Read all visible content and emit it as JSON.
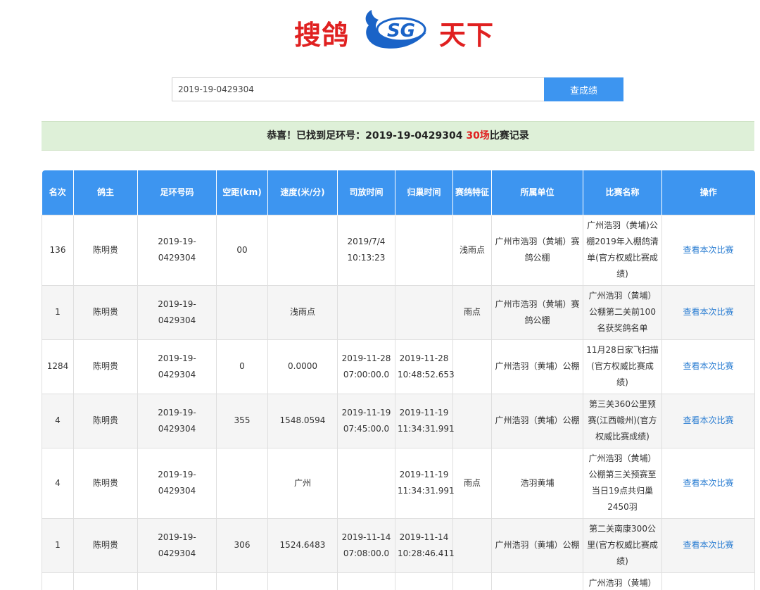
{
  "logo": {
    "left_text": "搜鸽",
    "right_text": "天下",
    "mark_text": "SG",
    "brand_red": "#e02020",
    "brand_blue": "#1a63c7"
  },
  "search": {
    "value": "2019-19-0429304",
    "placeholder": "",
    "button_label": "查成绩"
  },
  "banner": {
    "prefix": "恭喜！已找到足环号：2019-19-0429304",
    "count": "30场",
    "suffix": "比赛记录"
  },
  "table": {
    "headers": [
      "名次",
      "鸽主",
      "足环号码",
      "空距(km)",
      "速度(米/分)",
      "司放时间",
      "归巢时间",
      "赛鸽特征",
      "所属单位",
      "比赛名称",
      "操作"
    ],
    "rows": [
      {
        "rank": "136",
        "owner": "陈明贵",
        "ring": "2019-19-0429304",
        "distance": "00",
        "speed": "",
        "release": "2019/7/4\n10:13:23",
        "arrival": "",
        "feature": "浅雨点",
        "unit": "广州市浩羽（黄埔）赛鸽公棚",
        "race": "广州浩羽（黄埔)公棚2019年入棚鸽清单(官方权威比赛成绩)",
        "action": "查看本次比赛"
      },
      {
        "rank": "1",
        "owner": "陈明贵",
        "ring": "2019-19-0429304",
        "distance": "",
        "speed": "浅雨点",
        "release": "",
        "arrival": "",
        "feature": "雨点",
        "unit": "广州市浩羽（黄埔）赛鸽公棚",
        "race": "广州浩羽（黄埔）公棚第二关前100名获奖鸽名单",
        "action": "查看本次比赛"
      },
      {
        "rank": "1284",
        "owner": "陈明贵",
        "ring": "2019-19-0429304",
        "distance": "0",
        "speed": "0.0000",
        "release": "2019-11-28\n07:00:00.0",
        "arrival": "2019-11-28\n10:48:52.653",
        "feature": "",
        "unit": "广州浩羽（黄埔）公棚",
        "race": "11月28日家飞扫描(官方权威比赛成绩)",
        "action": "查看本次比赛"
      },
      {
        "rank": "4",
        "owner": "陈明贵",
        "ring": "2019-19-0429304",
        "distance": "355",
        "speed": "1548.0594",
        "release": "2019-11-19\n07:45:00.0",
        "arrival": "2019-11-19\n11:34:31.991",
        "feature": "",
        "unit": "广州浩羽（黄埔）公棚",
        "race": "第三关360公里预赛(江西赣州)(官方权威比赛成绩)",
        "action": "查看本次比赛"
      },
      {
        "rank": "4",
        "owner": "陈明贵",
        "ring": "2019-19-0429304",
        "distance": "",
        "speed": "广州",
        "release": "",
        "arrival": "2019-11-19\n11:34:31.991",
        "feature": "雨点",
        "unit": "浩羽黄埔",
        "race": "广州浩羽（黄埔）公棚第三关预赛至当日19点共归巢2450羽",
        "action": "查看本次比赛"
      },
      {
        "rank": "1",
        "owner": "陈明贵",
        "ring": "2019-19-0429304",
        "distance": "306",
        "speed": "1524.6483",
        "release": "2019-11-14\n07:08:00.0",
        "arrival": "2019-11-14\n10:28:46.411",
        "feature": "",
        "unit": "广州浩羽（黄埔）公棚",
        "race": "第二关南康300公里(官方权威比赛成绩)",
        "action": "查看本次比赛"
      },
      {
        "rank": "",
        "owner": "",
        "ring": "",
        "distance": "",
        "speed": "",
        "release": "",
        "arrival": "",
        "feature": "",
        "unit": "",
        "race": "广州浩羽（黄埔）",
        "action": ""
      }
    ]
  }
}
